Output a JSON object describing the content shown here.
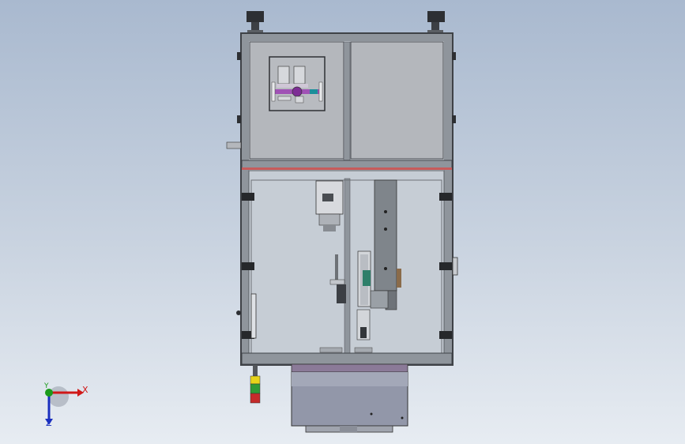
{
  "viewport": {
    "background_top": "#a9b9cf",
    "background_bottom": "#e7ecf2"
  },
  "model": {
    "frame_color": "#8f959c",
    "panel_color": "#b4b7bc",
    "enclosure_color": "#c6cdd5",
    "separator_color": "#c75b5b",
    "base_color": "#9297a9",
    "belt_color": "#7f858b",
    "accent_purple": "#9b3fb3",
    "signal_light": {
      "colors": [
        "#e7d41a",
        "#2f9a36",
        "#c42b2b"
      ]
    }
  },
  "triad": {
    "x_label": "X",
    "z_label": "Z",
    "y_label": "Y",
    "x_color": "#d01818",
    "y_color": "#1b9a1b",
    "z_color": "#1a2fbf"
  }
}
